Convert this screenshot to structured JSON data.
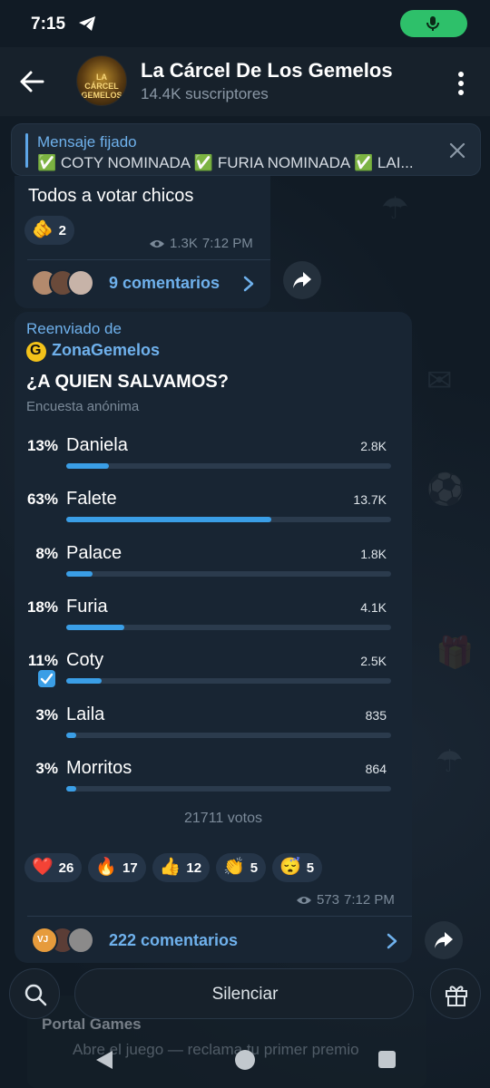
{
  "status": {
    "time": "7:15"
  },
  "header": {
    "title": "La Cárcel De Los Gemelos",
    "subscribers": "14.4K suscriptores",
    "avatar_text": "LA CÁRCEL GEMELOS"
  },
  "pinned": {
    "title": "Mensaje fijado",
    "text": "✅ COTY NOMINADA ✅ FURIA NOMINADA ✅ LAI..."
  },
  "message1": {
    "text": "Todos a votar chicos",
    "reaction": {
      "emoji": "🫵",
      "count": "2"
    },
    "views": "1.3K",
    "time": "7:12 PM",
    "comments": "9 comentarios"
  },
  "message2": {
    "forwarded_label": "Reenviado de",
    "forwarded_from": "ZonaGemelos",
    "poll_question": "¿A QUIEN SALVAMOS?",
    "poll_type": "Encuesta anónima",
    "options": [
      {
        "pct": "13%",
        "name": "Daniela",
        "votes": "2.8K",
        "fraction": 0.13,
        "checked": false
      },
      {
        "pct": "63%",
        "name": "Falete",
        "votes": "13.7K",
        "fraction": 0.63,
        "checked": false
      },
      {
        "pct": "8%",
        "name": "Palace",
        "votes": "1.8K",
        "fraction": 0.08,
        "checked": false
      },
      {
        "pct": "18%",
        "name": "Furia",
        "votes": "4.1K",
        "fraction": 0.18,
        "checked": false
      },
      {
        "pct": "11%",
        "name": "Coty",
        "votes": "2.5K",
        "fraction": 0.11,
        "checked": true
      },
      {
        "pct": "3%",
        "name": "Laila",
        "votes": "835",
        "fraction": 0.03,
        "checked": false
      },
      {
        "pct": "3%",
        "name": "Morritos",
        "votes": "864",
        "fraction": 0.03,
        "checked": false
      }
    ],
    "total_votes": "21711 votos",
    "reactions": [
      {
        "emoji": "❤️",
        "count": "26"
      },
      {
        "emoji": "🔥",
        "count": "17"
      },
      {
        "emoji": "👍",
        "count": "12"
      },
      {
        "emoji": "👏",
        "count": "5"
      },
      {
        "emoji": "😴",
        "count": "5"
      }
    ],
    "views": "573",
    "time": "7:12 PM",
    "comments": "222 comentarios",
    "commenter_initials": "VJ"
  },
  "bottom": {
    "mute_label": "Silenciar",
    "behind_title": "Portal Games",
    "behind_sub": "Abre el juego — reclama tu primer premio"
  },
  "colors": {
    "accent": "#3a9ee6",
    "link": "#6fb1ec",
    "bubble": "#182533",
    "mic": "#2ec06a"
  }
}
